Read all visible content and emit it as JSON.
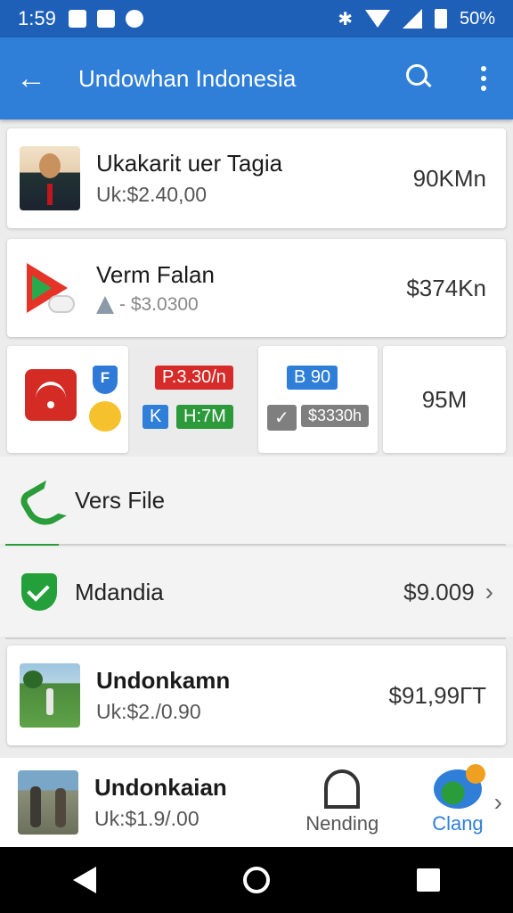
{
  "status_bar": {
    "time": "1:59",
    "battery": "50%"
  },
  "appbar": {
    "title": "Undowhan Indonesia"
  },
  "items": [
    {
      "name": "Ukakarit uer Tagia",
      "sub": "Uk:$2.40,00",
      "value": "90KMn"
    },
    {
      "name": "Verm Falan",
      "sub": "- $3.0300",
      "value": "$374Kn"
    },
    {
      "name": "Undonkamn",
      "sub": "Uk:$2./0.90",
      "value": "$91,99ГТ"
    },
    {
      "name": "Undonkaian",
      "sub": "Uk:$1.9/.00"
    }
  ],
  "tiles": {
    "shield_letter": "F",
    "chip_red": "P.3.30/n",
    "chip_blue_k": "K",
    "chip_green": "H:7M",
    "chip_blue_b": "B 90",
    "chip_check": "✓",
    "chip_grey": "$3330h",
    "value": "95M"
  },
  "phone_row": {
    "label": "Vers File"
  },
  "check_row": {
    "label": "Mdandia",
    "value": "$9.009"
  },
  "actions": [
    {
      "label": "Nending",
      "icon": "door-icon"
    },
    {
      "label": "Clang",
      "icon": "globe-icon"
    }
  ],
  "colors": {
    "primary": "#2f7fd8",
    "status": "#1e5fb8",
    "green": "#2a9c39",
    "red": "#d62b28"
  }
}
